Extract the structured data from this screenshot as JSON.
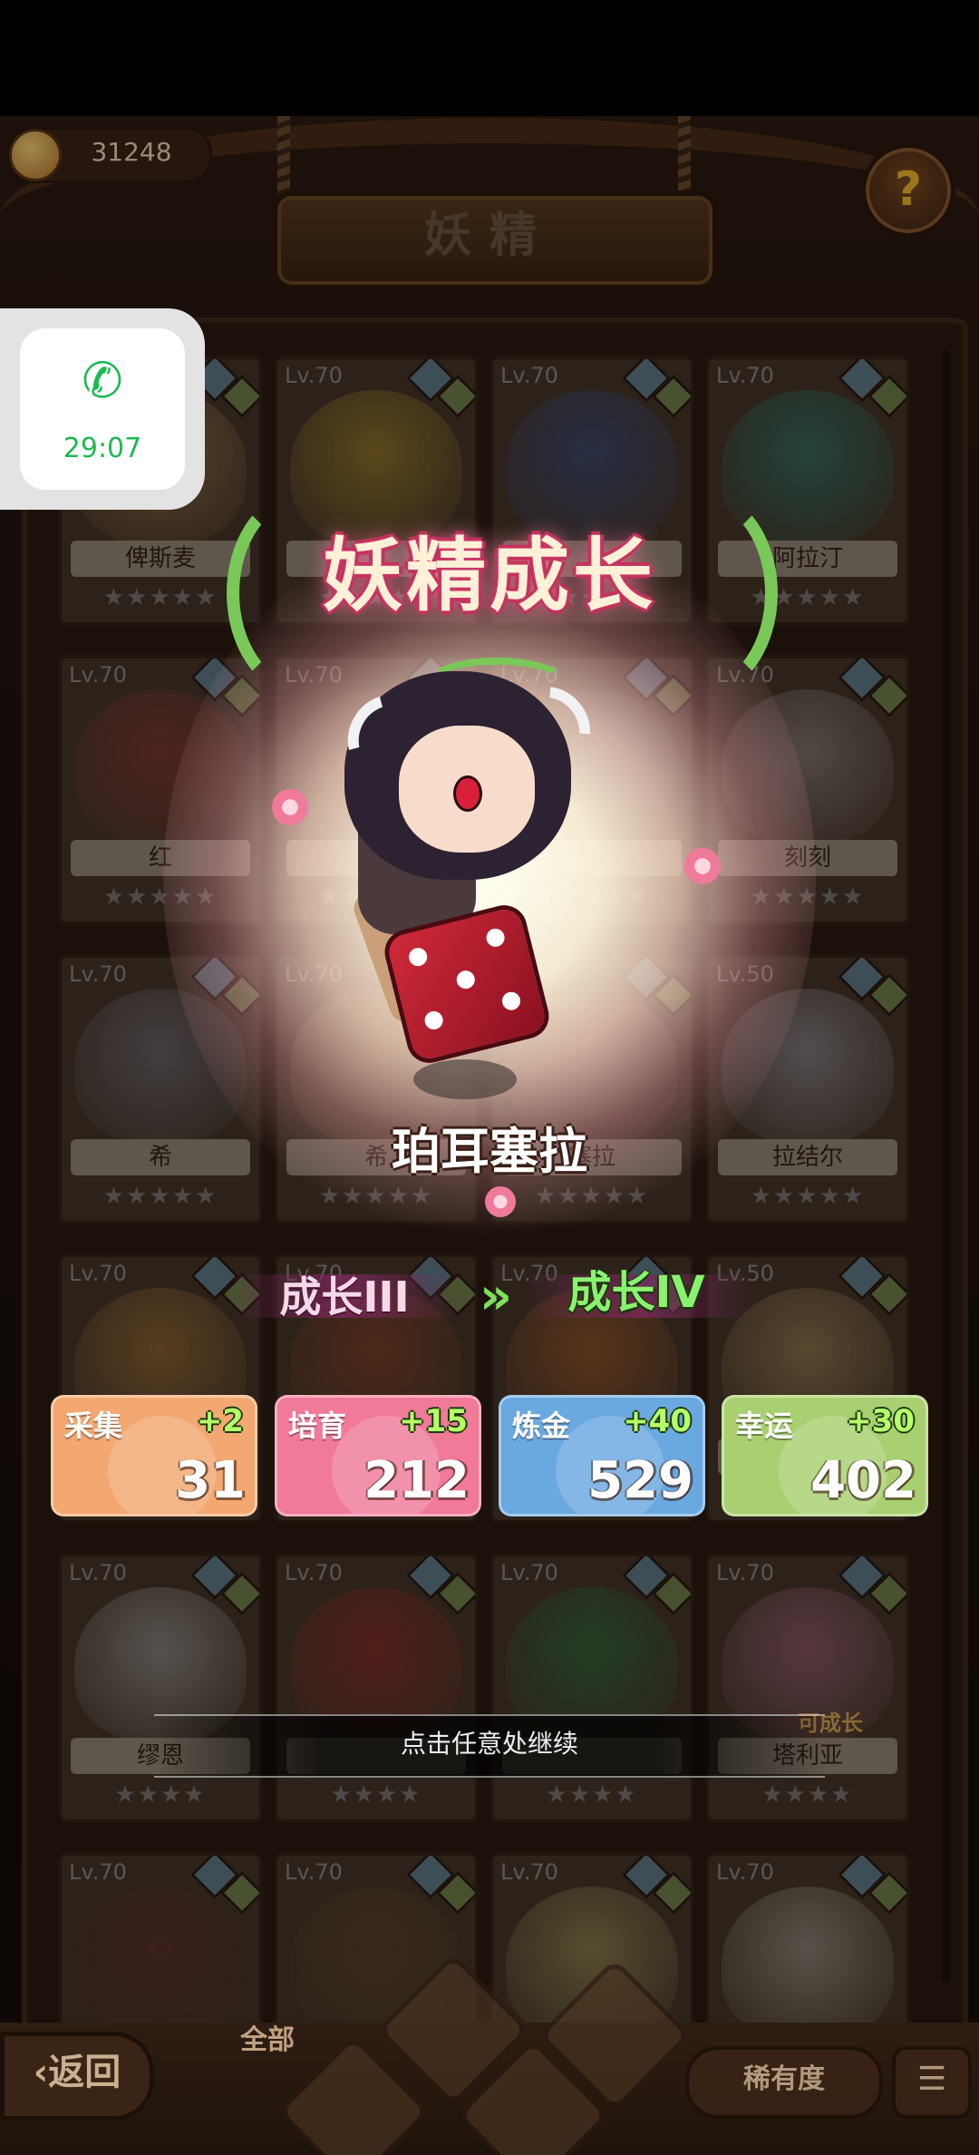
{
  "header": {
    "coins": "31248",
    "title": "妖精",
    "help_icon": "question-icon"
  },
  "cards": [
    {
      "lv": "Lv.70",
      "name": "俾斯麦",
      "stars": "★★★★★",
      "color": "#e0b070"
    },
    {
      "lv": "Lv.70",
      "name": "",
      "stars": "★★★★★",
      "color": "#e8c040"
    },
    {
      "lv": "Lv.70",
      "name": "",
      "stars": "★★★★★",
      "color": "#5070c0"
    },
    {
      "lv": "Lv.70",
      "name": "阿拉汀",
      "stars": "★★★★★",
      "color": "#40b0a0"
    },
    {
      "lv": "Lv.70",
      "name": "红",
      "stars": "★★★★★",
      "color": "#c05050"
    },
    {
      "lv": "Lv.70",
      "name": "",
      "stars": "★★★★★",
      "color": "#a07060"
    },
    {
      "lv": "Lv.70",
      "name": "",
      "stars": "★★★★★",
      "color": "#9070b0"
    },
    {
      "lv": "Lv.70",
      "name": "刻刻",
      "stars": "★★★★★",
      "color": "#d0c0c0"
    },
    {
      "lv": "Lv.70",
      "name": "希",
      "stars": "★★★★★",
      "color": "#a0a0b0"
    },
    {
      "lv": "Lv.70",
      "name": "希",
      "stars": "★★★★★",
      "color": "#d0c080"
    },
    {
      "lv": "Lv.70",
      "name": "塞拉",
      "stars": "★★★★★",
      "color": "#c08080"
    },
    {
      "lv": "Lv.50",
      "name": "拉结尔",
      "stars": "★★★★★",
      "color": "#d0d0e0"
    },
    {
      "lv": "Lv.70",
      "name": "",
      "stars": "★★★★★",
      "color": "#e0a050"
    },
    {
      "lv": "Lv.70",
      "name": "",
      "stars": "★★★★★",
      "color": "#c06040"
    },
    {
      "lv": "Lv.70",
      "name": "",
      "stars": "★★★★★",
      "color": "#e08040"
    },
    {
      "lv": "Lv.50",
      "name": "",
      "stars": "★★★★★",
      "color": "#e0c080"
    },
    {
      "lv": "Lv.70",
      "name": "缪恩",
      "stars": "★★★★",
      "color": "#e0e0e0"
    },
    {
      "lv": "Lv.70",
      "name": "",
      "stars": "★★★★",
      "color": "#d04040"
    },
    {
      "lv": "Lv.70",
      "name": "",
      "stars": "★★★★",
      "color": "#40a060"
    },
    {
      "lv": "Lv.70",
      "name": "塔利亚",
      "stars": "★★★★",
      "color": "#e090b0"
    },
    {
      "lv": "Lv.70",
      "name": "",
      "stars": "",
      "color": "#804040"
    },
    {
      "lv": "Lv.70",
      "name": "",
      "stars": "",
      "color": "#806040"
    },
    {
      "lv": "Lv.70",
      "name": "",
      "stars": "",
      "color": "#e0d080"
    },
    {
      "lv": "Lv.70",
      "name": "",
      "stars": "",
      "color": "#e0e0d0"
    }
  ],
  "popup": {
    "banner": "妖精成长",
    "character_name": "珀耳塞拉",
    "growth_from": "成长III",
    "growth_to": "成长IV",
    "stats": [
      {
        "label": "采集",
        "plus": "+2",
        "value": "31",
        "color": "#f2a870"
      },
      {
        "label": "培育",
        "plus": "+15",
        "value": "212",
        "color": "#f07a98"
      },
      {
        "label": "炼金",
        "plus": "+40",
        "value": "529",
        "color": "#6aa8e0"
      },
      {
        "label": "幸运",
        "plus": "+30",
        "value": "402",
        "color": "#a8d070"
      }
    ],
    "continue_text": "点击任意处继续"
  },
  "card_badge": "可成长",
  "bottom_nav": {
    "back_label": "返回",
    "tab_all": "全部",
    "rarity_label": "稀有度",
    "sort_icon": "sort-icon"
  },
  "call_overlay": {
    "time": "29:07",
    "icon": "phone-icon"
  }
}
